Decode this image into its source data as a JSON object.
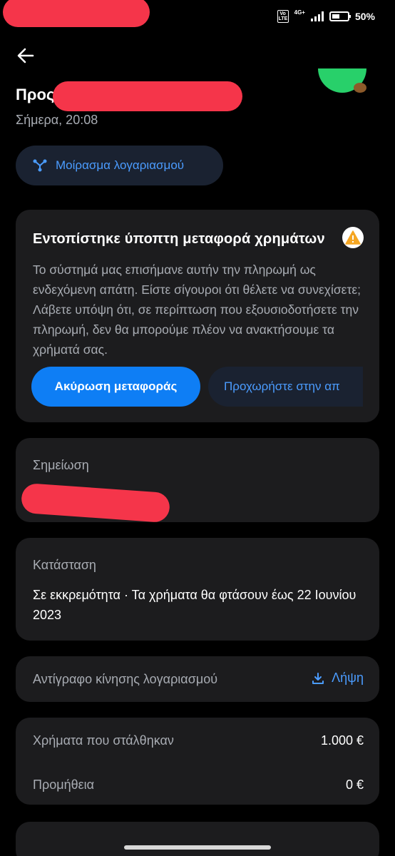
{
  "status_bar": {
    "volte": "Vo LTE",
    "network": "4G+",
    "battery_percent": "50%",
    "battery_level": 0.5
  },
  "header": {
    "title_prefix": "Προς",
    "date": "Σήμερα, 20:08",
    "share_label": "Μοίρασμα λογαριασμού"
  },
  "alert": {
    "title": "Εντοπίστηκε ύποπτη μεταφορά χρημάτων",
    "body": "Το σύστημά μας επισήμανε αυτήν την πληρωμή ως ενδεχόμενη απάτη. Είστε σίγουροι ότι θέλετε να συνεχίσετε; Λάβετε υπόψη ότι, σε περίπτωση που εξουσιοδοτήσετε την πληρωμή, δεν θα μπορούμε πλέον να ανακτήσουμε τα χρήματά σας.",
    "cancel_label": "Ακύρωση μεταφοράς",
    "proceed_label": "Προχωρήστε στην απ"
  },
  "note": {
    "label": "Σημείωση"
  },
  "state": {
    "label": "Κατάσταση",
    "value": "Σε εκκρεμότητα · Τα χρήματα θα φτάσουν έως 22 Ιουνίου 2023"
  },
  "statement": {
    "label": "Αντίγραφο κίνησης λογαριασμού",
    "download_label": "Λήψη"
  },
  "money": {
    "sent_label": "Χρήματα που στάλθηκαν",
    "sent_value": "1.000 €",
    "fee_label": "Προμήθεια",
    "fee_value": "0 €"
  },
  "colors": {
    "accent": "#0e7ef5",
    "link": "#4b9cff",
    "card": "#1c1c1e",
    "warning": "#f5a623",
    "redaction": "#f5354a"
  }
}
